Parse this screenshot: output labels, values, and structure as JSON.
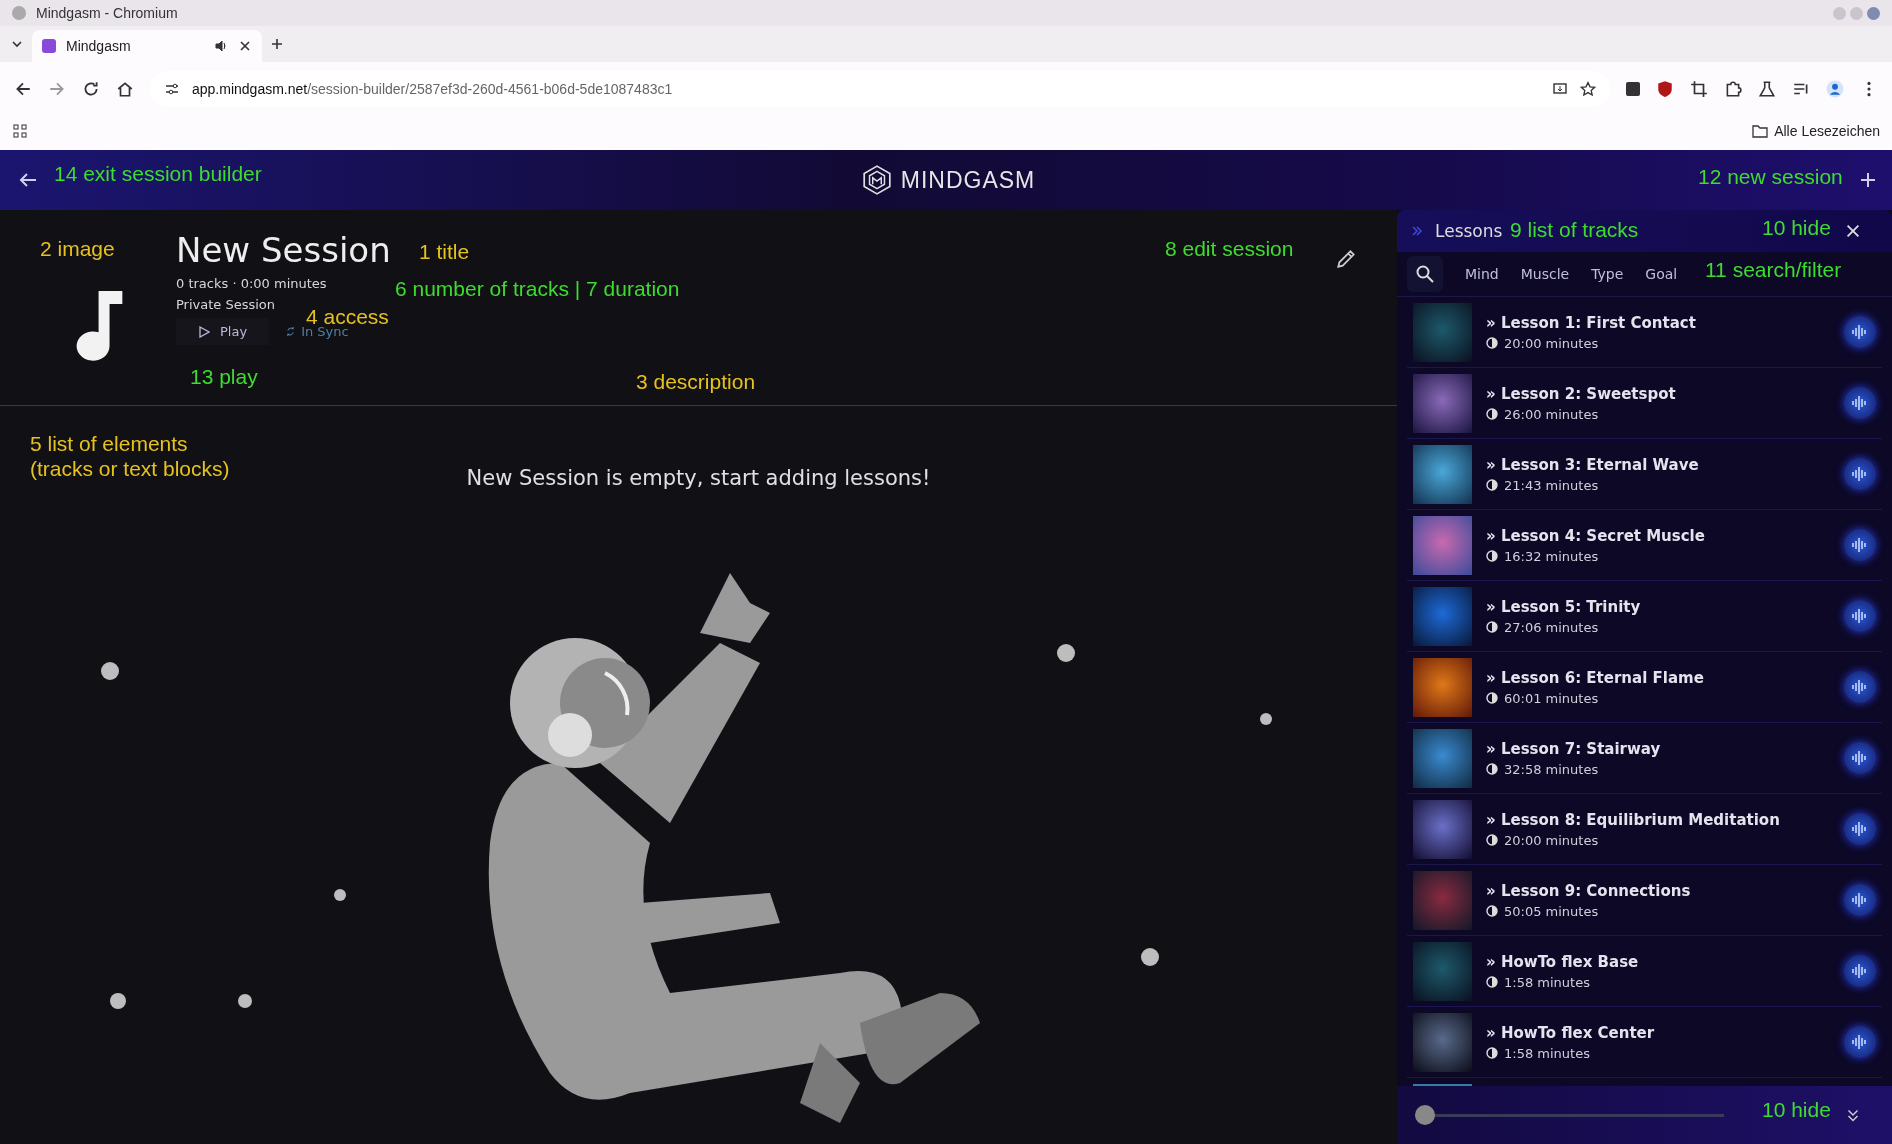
{
  "browser": {
    "window_title": "Mindgasm - Chromium",
    "tab": {
      "title": "Mindgasm",
      "selected": true
    },
    "url_domain": "app.mindgasm.net",
    "url_path": "/session-builder/2587ef3d-260d-4561-b06d-5de1087483c1",
    "bookmarks_label": "Alle Lesezeichen"
  },
  "header": {
    "logo": "MINDGASM"
  },
  "session": {
    "title": "New Session",
    "meta": "0 tracks · 0:00 minutes",
    "access": "Private Session",
    "play_label": "Play",
    "sync_label": "In Sync",
    "empty_message": "New Session is empty, start adding lessons!"
  },
  "panel": {
    "title": "Lessons",
    "filters": [
      "Mind",
      "Muscle",
      "Type",
      "Goal"
    ],
    "tracks": [
      {
        "title": "» Lesson 1: First Contact",
        "duration": "20:00 minutes"
      },
      {
        "title": "» Lesson 2: Sweetspot",
        "duration": "26:00 minutes"
      },
      {
        "title": "» Lesson 3: Eternal Wave",
        "duration": "21:43 minutes"
      },
      {
        "title": "» Lesson 4: Secret Muscle",
        "duration": "16:32 minutes"
      },
      {
        "title": "» Lesson 5: Trinity",
        "duration": "27:06 minutes"
      },
      {
        "title": "» Lesson 6: Eternal Flame",
        "duration": "60:01 minutes"
      },
      {
        "title": "» Lesson 7: Stairway",
        "duration": "32:58 minutes"
      },
      {
        "title": "» Lesson 8: Equilibrium Meditation",
        "duration": "20:00 minutes"
      },
      {
        "title": "» Lesson 9: Connections",
        "duration": "50:05 minutes"
      },
      {
        "title": "» HowTo flex Base",
        "duration": "1:58 minutes"
      },
      {
        "title": "» HowTo flex Center",
        "duration": "1:58 minutes"
      }
    ],
    "player": {
      "level": 0
    }
  },
  "annotations": [
    {
      "text": "14 exit session builder",
      "color": "#3ddc2f"
    },
    {
      "text": "12 new session",
      "color": "#3ddc2f"
    },
    {
      "text": "2 image",
      "color": "#e6c21e"
    },
    {
      "text": "1 title",
      "color": "#e6c21e"
    },
    {
      "text": "8 edit session",
      "color": "#3ddc2f"
    },
    {
      "text": "6 number of tracks | 7 duration",
      "color": "#3ddc2f"
    },
    {
      "text": "4 access",
      "color": "#e6c21e"
    },
    {
      "text": "13 play",
      "color": "#3ddc2f"
    },
    {
      "text": "3 description",
      "color": "#e6c21e"
    },
    {
      "text": "5 list of elements\n(tracks or text blocks)",
      "color": "#e6c21e"
    },
    {
      "text": "9 list of tracks",
      "color": "#3ddc2f"
    },
    {
      "text": "10 hide",
      "color": "#3ddc2f"
    },
    {
      "text": "11 search/filter",
      "color": "#3ddc2f"
    },
    {
      "text": "10 hide",
      "color": "#3ddc2f"
    }
  ]
}
